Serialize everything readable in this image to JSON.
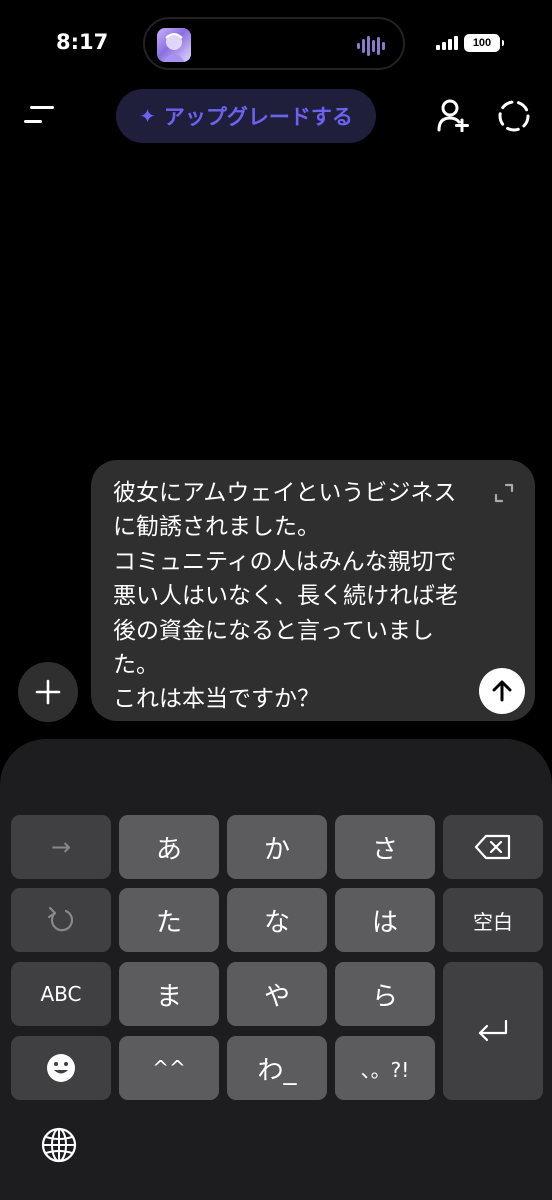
{
  "status_bar": {
    "time": "8:17",
    "battery": "100"
  },
  "toolbar": {
    "menu_icon": "hamburger-menu-icon",
    "upgrade_label": "アップグレードする",
    "upgrade_icon": "sparkle-icon",
    "add_user_icon": "add-person-icon",
    "temp_chat_icon": "dashed-circle-icon"
  },
  "composer": {
    "text": "彼女にアムウェイというビジネスに勧誘されました。\nコミュニティの人はみんな親切で悪い人はいなく、長く続ければ老後の資金になると言っていました。\nこれは本当ですか？",
    "expand_icon": "expand-icon",
    "send_icon": "arrow-up-icon",
    "attach_icon": "plus-icon"
  },
  "keyboard": {
    "row1": [
      "→",
      "あ",
      "か",
      "さ",
      "⌫"
    ],
    "row2": [
      "↺",
      "た",
      "な",
      "は",
      "空白"
    ],
    "row3": [
      "ABC",
      "ま",
      "や",
      "ら",
      "⏎"
    ],
    "row4": [
      "☻",
      "^^",
      "わ_",
      "、。?!"
    ],
    "globe_icon": "globe-icon"
  },
  "colors": {
    "accent": "#6b63f0",
    "upgrade_bg": "#1f1e3b",
    "composer_bg": "#2f2f2f",
    "key_bg": "#5c5c5e",
    "key_fn_bg": "#404042",
    "keyboard_bg": "#1d1d1f"
  }
}
